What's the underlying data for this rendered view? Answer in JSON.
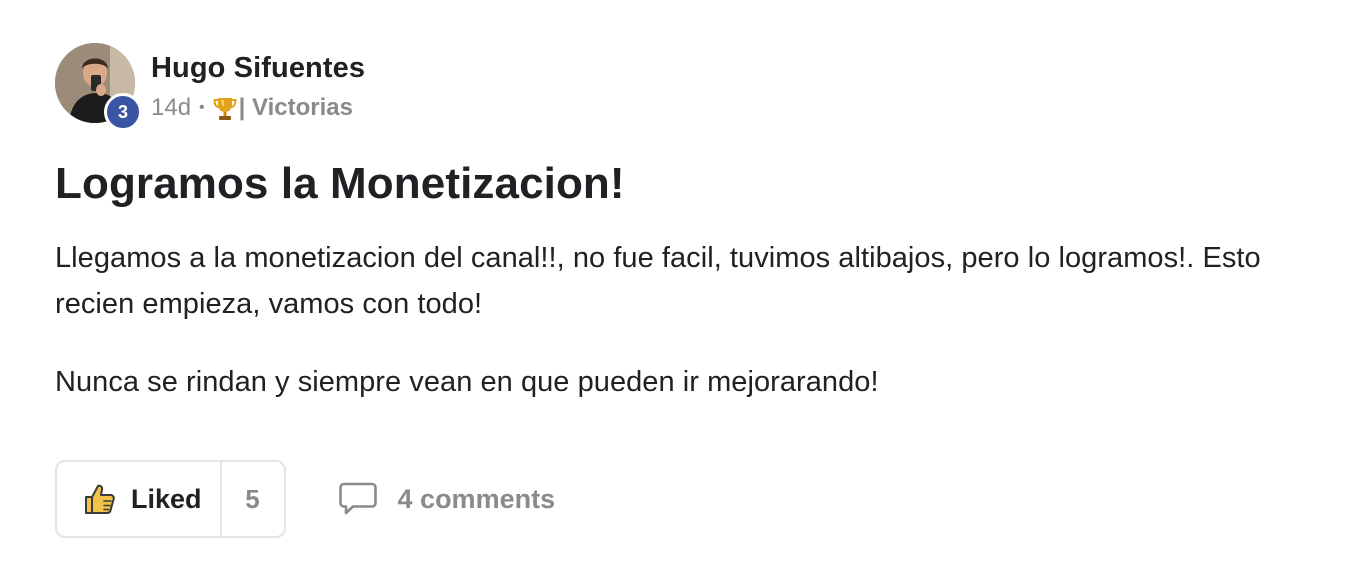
{
  "author": {
    "name": "Hugo Sifuentes",
    "level": "3"
  },
  "meta": {
    "time": "14d",
    "separator": "•",
    "category_icon": "trophy-icon",
    "category": "| Victorias"
  },
  "post": {
    "title": "Logramos la Monetizacion!",
    "paragraphs": [
      "Llegamos a la monetizacion del canal!!, no fue facil, tuvimos altibajos, pero lo logramos!. Esto recien empieza, vamos con todo!",
      "Nunca se rindan y siempre vean en que pueden ir mejorarando!"
    ]
  },
  "actions": {
    "like_label": "Liked",
    "like_count": "5",
    "comments_label": "4 comments"
  },
  "colors": {
    "level_badge": "#3a55a4",
    "muted_text": "#8a8a8a",
    "primary_text": "#202124",
    "like_icon": "#f3c24a",
    "border": "#e4e4e4"
  }
}
